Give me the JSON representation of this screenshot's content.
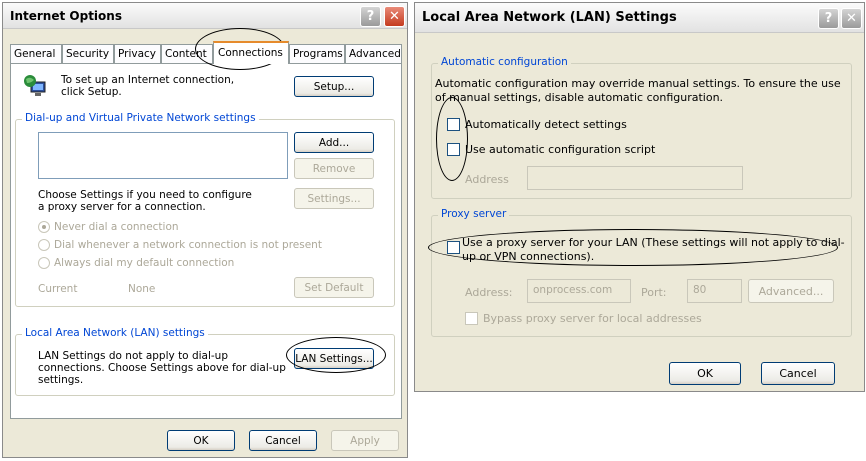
{
  "internet_options": {
    "title": "Internet Options",
    "tabs": [
      "General",
      "Security",
      "Privacy",
      "Content",
      "Connections",
      "Programs",
      "Advanced"
    ],
    "setup_text": "To set up an Internet connection, click Setup.",
    "setup_button": "Setup...",
    "dialup_group_title": "Dial-up and Virtual Private Network settings",
    "add_button": "Add...",
    "remove_button": "Remove",
    "proxy_hint": "Choose Settings if you need to configure a proxy server for a connection.",
    "settings_button": "Settings...",
    "radio_never": "Never dial a connection",
    "radio_whenever": "Dial whenever a network connection is not present",
    "radio_always": "Always dial my default connection",
    "current_label": "Current",
    "current_value": "None",
    "set_default_button": "Set Default",
    "lan_group_title": "Local Area Network (LAN) settings",
    "lan_text": "LAN Settings do not apply to dial-up connections. Choose Settings above for dial-up settings.",
    "lan_settings_button": "LAN Settings...",
    "ok": "OK",
    "cancel": "Cancel",
    "apply": "Apply"
  },
  "lan_settings": {
    "title": "Local Area Network (LAN) Settings",
    "auto_group_title": "Automatic configuration",
    "auto_desc": "Automatic configuration may override manual settings.  To ensure the use of manual settings, disable automatic configuration.",
    "auto_detect": "Automatically detect settings",
    "auto_script": "Use automatic configuration script",
    "address_label": "Address",
    "proxy_group_title": "Proxy server",
    "use_proxy": "Use a proxy server for your LAN (These settings will not apply to dial-up or VPN connections).",
    "proxy_address_label": "Address:",
    "proxy_address_value": "onprocess.com",
    "port_label": "Port:",
    "port_value": "80",
    "advanced_button": "Advanced...",
    "bypass": "Bypass proxy server for local addresses",
    "ok": "OK",
    "cancel": "Cancel"
  },
  "colors": {
    "group_title": "#0046d5",
    "dialog_bg": "#ece9d8",
    "disabled_text": "#aca899"
  }
}
